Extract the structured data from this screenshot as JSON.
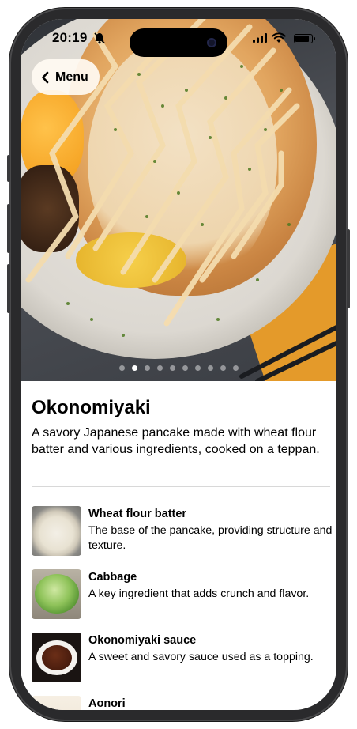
{
  "status_bar": {
    "time": "20:19"
  },
  "nav": {
    "back_label": "Menu"
  },
  "carousel": {
    "page_count": 10,
    "active_index": 1
  },
  "dish": {
    "name": "Okonomiyaki",
    "description": "A savory Japanese pancake made with wheat flour batter and various ingredients, cooked on a teppan."
  },
  "ingredients": [
    {
      "name": "Wheat flour batter",
      "description": "The base of the pancake, providing structure and texture.",
      "icon": "wheat-flour-batter-photo"
    },
    {
      "name": "Cabbage",
      "description": "A key ingredient that adds crunch and flavor.",
      "icon": "cabbage-photo"
    },
    {
      "name": "Okonomiyaki sauce",
      "description": "A sweet and savory sauce used as a topping.",
      "icon": "okonomiyaki-sauce-photo"
    },
    {
      "name": "Aonori",
      "description": "",
      "icon": "aonori-photo"
    }
  ],
  "colors": {
    "accent_napkin": "#e49a2a",
    "mayo": "#f4dcae"
  }
}
